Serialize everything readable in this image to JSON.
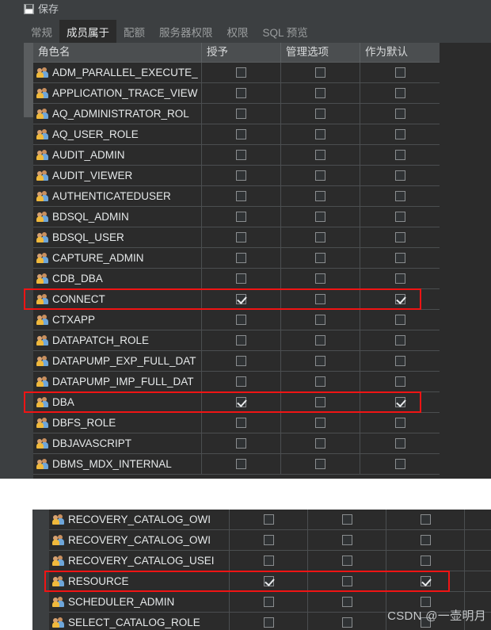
{
  "window": {
    "title": "保存",
    "icon": "save-icon"
  },
  "tabs": [
    {
      "label": "常规",
      "active": false
    },
    {
      "label": "成员属于",
      "active": true
    },
    {
      "label": "配额",
      "active": false
    },
    {
      "label": "服务器权限",
      "active": false
    },
    {
      "label": "权限",
      "active": false
    },
    {
      "label": "SQL 预览",
      "active": false
    }
  ],
  "grid": {
    "columns": [
      "角色名",
      "授予",
      "管理选项",
      "作为默认"
    ],
    "rows": [
      {
        "name": "ADM_PARALLEL_EXECUTE_",
        "grant": false,
        "admin": false,
        "default": false,
        "highlight": false
      },
      {
        "name": "APPLICATION_TRACE_VIEW",
        "grant": false,
        "admin": false,
        "default": false,
        "highlight": false
      },
      {
        "name": "AQ_ADMINISTRATOR_ROL",
        "grant": false,
        "admin": false,
        "default": false,
        "highlight": false
      },
      {
        "name": "AQ_USER_ROLE",
        "grant": false,
        "admin": false,
        "default": false,
        "highlight": false
      },
      {
        "name": "AUDIT_ADMIN",
        "grant": false,
        "admin": false,
        "default": false,
        "highlight": false
      },
      {
        "name": "AUDIT_VIEWER",
        "grant": false,
        "admin": false,
        "default": false,
        "highlight": false
      },
      {
        "name": "AUTHENTICATEDUSER",
        "grant": false,
        "admin": false,
        "default": false,
        "highlight": false
      },
      {
        "name": "BDSQL_ADMIN",
        "grant": false,
        "admin": false,
        "default": false,
        "highlight": false
      },
      {
        "name": "BDSQL_USER",
        "grant": false,
        "admin": false,
        "default": false,
        "highlight": false
      },
      {
        "name": "CAPTURE_ADMIN",
        "grant": false,
        "admin": false,
        "default": false,
        "highlight": false
      },
      {
        "name": "CDB_DBA",
        "grant": false,
        "admin": false,
        "default": false,
        "highlight": false
      },
      {
        "name": "CONNECT",
        "grant": true,
        "admin": false,
        "default": true,
        "highlight": true
      },
      {
        "name": "CTXAPP",
        "grant": false,
        "admin": false,
        "default": false,
        "highlight": false
      },
      {
        "name": "DATAPATCH_ROLE",
        "grant": false,
        "admin": false,
        "default": false,
        "highlight": false
      },
      {
        "name": "DATAPUMP_EXP_FULL_DAT",
        "grant": false,
        "admin": false,
        "default": false,
        "highlight": false
      },
      {
        "name": "DATAPUMP_IMP_FULL_DAT",
        "grant": false,
        "admin": false,
        "default": false,
        "highlight": false
      },
      {
        "name": "DBA",
        "grant": true,
        "admin": false,
        "default": true,
        "highlight": true
      },
      {
        "name": "DBFS_ROLE",
        "grant": false,
        "admin": false,
        "default": false,
        "highlight": false
      },
      {
        "name": "DBJAVASCRIPT",
        "grant": false,
        "admin": false,
        "default": false,
        "highlight": false
      },
      {
        "name": "DBMS_MDX_INTERNAL",
        "grant": false,
        "admin": false,
        "default": false,
        "highlight": false
      }
    ]
  },
  "grid2": {
    "rows": [
      {
        "name": "RECOVERY_CATALOG_OWI",
        "grant": false,
        "admin": false,
        "default": false,
        "highlight": false
      },
      {
        "name": "RECOVERY_CATALOG_OWI",
        "grant": false,
        "admin": false,
        "default": false,
        "highlight": false
      },
      {
        "name": "RECOVERY_CATALOG_USEI",
        "grant": false,
        "admin": false,
        "default": false,
        "highlight": false
      },
      {
        "name": "RESOURCE",
        "grant": true,
        "admin": false,
        "default": true,
        "highlight": true
      },
      {
        "name": "SCHEDULER_ADMIN",
        "grant": false,
        "admin": false,
        "default": false,
        "highlight": false
      },
      {
        "name": "SELECT_CATALOG_ROLE",
        "grant": false,
        "admin": false,
        "default": false,
        "highlight": false
      }
    ]
  },
  "watermark": "CSDN @一壶明月",
  "colors": {
    "dialog_bg": "#3c3f41",
    "grid_bg": "#2b2b2b",
    "header_bg": "#4b4e50",
    "text": "#e6e9ea",
    "highlight": "#f01414"
  }
}
